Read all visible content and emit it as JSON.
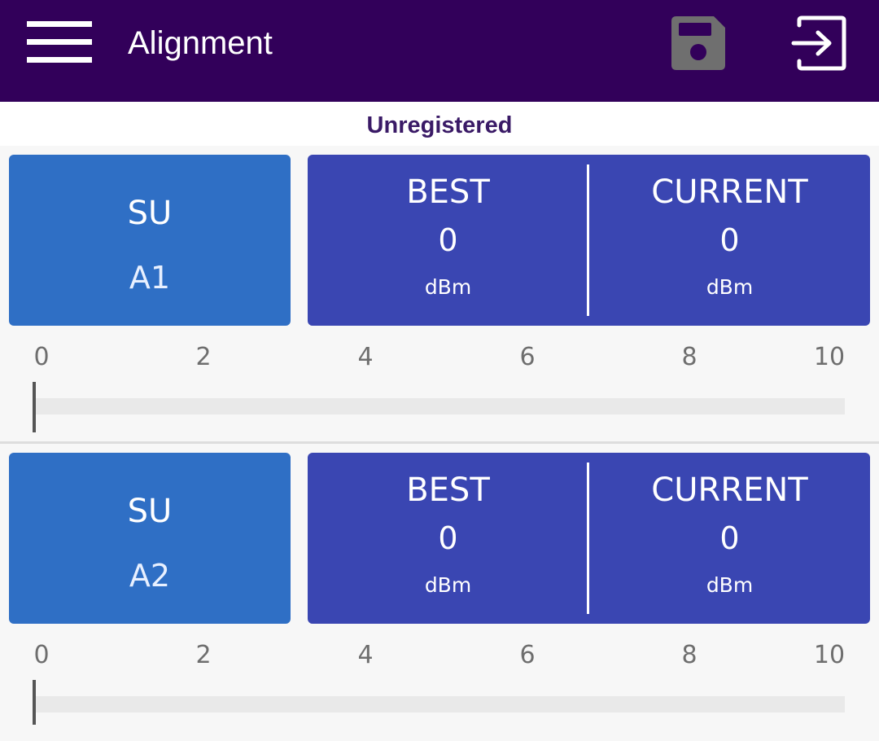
{
  "header": {
    "title": "Alignment",
    "menu_icon": "hamburger-menu-icon",
    "save_icon": "floppy-disk-icon",
    "exit_icon": "exit-icon",
    "background_color": "#32005a"
  },
  "status": {
    "text": "Unregistered",
    "color": "#3a1a66"
  },
  "scale": {
    "ticks": [
      "0",
      "2",
      "4",
      "6",
      "8",
      "10"
    ]
  },
  "units": [
    {
      "su_label": "SU",
      "su_id": "A1",
      "best_label": "BEST",
      "best_value": "0",
      "best_unit": "dBm",
      "current_label": "CURRENT",
      "current_value": "0",
      "current_unit": "dBm",
      "signal_level": 0
    },
    {
      "su_label": "SU",
      "su_id": "A2",
      "best_label": "BEST",
      "best_value": "0",
      "best_unit": "dBm",
      "current_label": "CURRENT",
      "current_value": "0",
      "current_unit": "dBm",
      "signal_level": 0
    }
  ],
  "colors": {
    "su_card": "#2f6fc5",
    "metric_card": "#3a46b2"
  }
}
